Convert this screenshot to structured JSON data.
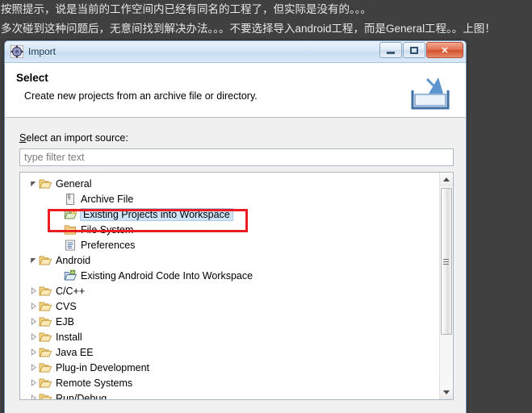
{
  "annotation": {
    "line1": "按照提示，说是当前的工作空间内已经有同名的工程了，但实际是没有的。。。",
    "line2": "多次碰到这种问题后，无意间找到解决办法。。。不要选择导入android工程，而是General工程。。上图！"
  },
  "dialog": {
    "title": "Import",
    "window_buttons": {
      "minimize": "minimize",
      "maximize": "maximize",
      "close": "✕"
    },
    "header": {
      "title": "Select",
      "description": "Create new projects from an archive file or directory."
    },
    "form": {
      "source_label_mnemonic": "S",
      "source_label_rest": "elect an import source:",
      "filter_placeholder": "type filter text",
      "filter_value": ""
    },
    "tree": {
      "items": [
        {
          "label": "General",
          "level": 1,
          "icon": "folder-open-icon",
          "twisty": "expanded",
          "selected": false
        },
        {
          "label": "Archive File",
          "level": 2,
          "icon": "archive-file-icon",
          "twisty": "none",
          "selected": false
        },
        {
          "label": "Existing Projects into Workspace",
          "level": 2,
          "icon": "existing-projects-icon",
          "twisty": "none",
          "selected": true
        },
        {
          "label": "File System",
          "level": 2,
          "icon": "file-system-icon",
          "twisty": "none",
          "selected": false
        },
        {
          "label": "Preferences",
          "level": 2,
          "icon": "preferences-icon",
          "twisty": "none",
          "selected": false
        },
        {
          "label": "Android",
          "level": 1,
          "icon": "folder-open-icon",
          "twisty": "expanded",
          "selected": false
        },
        {
          "label": "Existing Android Code Into Workspace",
          "level": 2,
          "icon": "android-code-icon",
          "twisty": "none",
          "selected": false
        },
        {
          "label": "C/C++",
          "level": 1,
          "icon": "folder-open-icon",
          "twisty": "collapsed",
          "selected": false
        },
        {
          "label": "CVS",
          "level": 1,
          "icon": "folder-open-icon",
          "twisty": "collapsed",
          "selected": false
        },
        {
          "label": "EJB",
          "level": 1,
          "icon": "folder-open-icon",
          "twisty": "collapsed",
          "selected": false
        },
        {
          "label": "Install",
          "level": 1,
          "icon": "folder-open-icon",
          "twisty": "collapsed",
          "selected": false
        },
        {
          "label": "Java EE",
          "level": 1,
          "icon": "folder-open-icon",
          "twisty": "collapsed",
          "selected": false
        },
        {
          "label": "Plug-in Development",
          "level": 1,
          "icon": "folder-open-icon",
          "twisty": "collapsed",
          "selected": false
        },
        {
          "label": "Remote Systems",
          "level": 1,
          "icon": "folder-open-icon",
          "twisty": "collapsed",
          "selected": false
        },
        {
          "label": "Run/Debug",
          "level": 1,
          "icon": "folder-open-icon",
          "twisty": "collapsed",
          "selected": false
        }
      ]
    }
  },
  "colors": {
    "page_background": "#404040",
    "annotation_text": "#e8e8e8",
    "selection_fill": "#cfe4f7",
    "selection_border": "#a8c9e8",
    "highlight_rectangle": "#ec1c24",
    "folder_icon": "#f0c060",
    "close_button": "#d2502c"
  }
}
